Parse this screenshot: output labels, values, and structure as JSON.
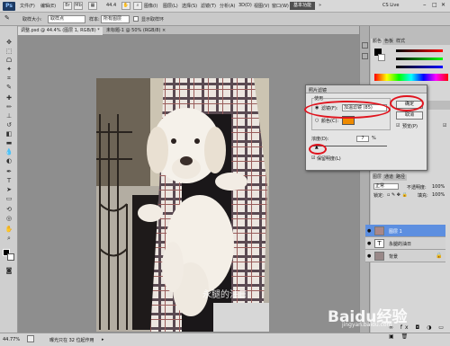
{
  "menubar": {
    "app_icon": "Ps",
    "items": [
      "文件(F)",
      "编辑(E)",
      "图像(I)",
      "图层(L)",
      "选择(S)",
      "滤镜(T)",
      "分析(A)",
      "3D(D)",
      "视图(V)",
      "窗口(W)",
      "帮助(H)"
    ],
    "zoom_value": "44.4",
    "workspace_label": "基本功能",
    "cs_live_label": "CS Live"
  },
  "options": {
    "tolerance_label": "取样大小:",
    "tolerance_value": "取样点",
    "sample_label": "样本:",
    "sample_value": "所有图层",
    "show_ring_label": "显示取样环"
  },
  "tabs": [
    {
      "label": "调整.psd @ 44.4% (图层 1, RGB/8) *"
    },
    {
      "label": "未标题-1 @ 50% (RGB/8) ×"
    }
  ],
  "toolbox": {
    "icons": [
      "move-icon",
      "marquee-icon",
      "lasso-icon",
      "quick-select-icon",
      "crop-icon",
      "eyedropper-icon",
      "healing-icon",
      "brush-icon",
      "stamp-icon",
      "history-brush-icon",
      "eraser-icon",
      "gradient-icon",
      "blur-icon",
      "dodge-icon",
      "pen-icon",
      "type-icon",
      "path-select-icon",
      "shape-icon",
      "3d-rotate-icon",
      "3d-camera-icon",
      "hand-icon",
      "zoom-icon"
    ]
  },
  "photo": {
    "watermark": "永腿的油日"
  },
  "status": {
    "zoom": "44.77%",
    "doc_info": "曝光只在 32 位起作用"
  },
  "color_panel": {
    "tabs": [
      "颜色",
      "色板",
      "样式"
    ]
  },
  "adjust_panel": {
    "tabs": [
      "调整",
      "蒙版"
    ]
  },
  "layers_panel": {
    "tabs": [
      "图层",
      "通道",
      "路径"
    ],
    "blend_mode": "正常",
    "opacity_label": "不透明度:",
    "opacity_value": "100%",
    "lock_label": "锁定:",
    "fill_label": "填充:",
    "fill_value": "100%",
    "layers": [
      {
        "name": "图层 1",
        "selected": true,
        "type": "image"
      },
      {
        "name": "永腿的油日",
        "selected": false,
        "type": "text"
      },
      {
        "name": "背景",
        "selected": false,
        "type": "image"
      }
    ]
  },
  "dialog": {
    "title": "照片滤镜",
    "group_label": "使用",
    "filter_radio_label": "滤镜(F):",
    "filter_value": "加温滤镜 (85)",
    "color_radio_label": "颜色(C):",
    "color_swatch": "#ee8a00",
    "density_label": "浓度(D):",
    "density_value": "7",
    "density_unit": "%",
    "density_fraction": 0.07,
    "preserve_label": "保留明度(L)",
    "ok_label": "确定",
    "cancel_label": "取消",
    "preview_label": "预览(P)"
  },
  "watermark_brand": "Baidu经验",
  "watermark_url": "jingyan.baidu.com",
  "highlight_color": "#e0141e"
}
